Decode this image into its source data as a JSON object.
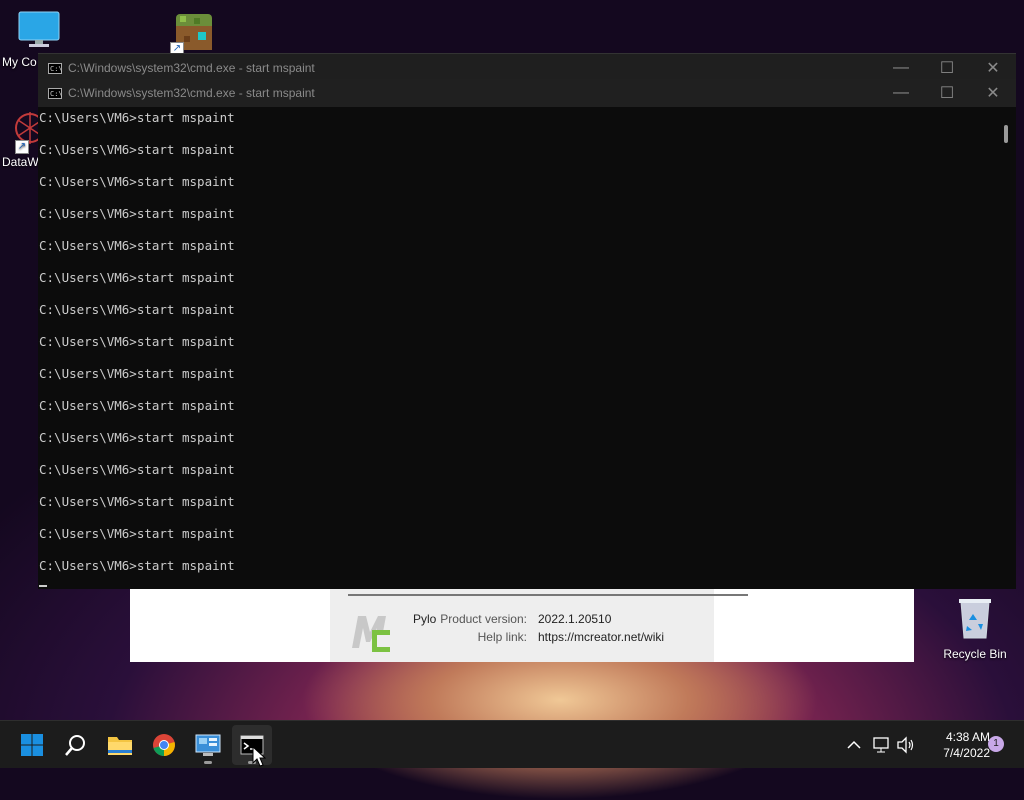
{
  "desktop": {
    "icons": [
      {
        "label": "My Co"
      },
      {
        "label": "DataW"
      }
    ],
    "recycle_bin": {
      "label": "Recycle Bin"
    }
  },
  "mcreator": {
    "name": "Pylo",
    "product_version_label": "Product version:",
    "product_version": "2022.1.20510",
    "help_link_label": "Help link:",
    "help_link": "https://mcreator.net/wiki"
  },
  "cmd_back": {
    "title": "C:\\Windows\\system32\\cmd.exe - start  mspaint",
    "icon_text": "C:\\"
  },
  "cmd_front": {
    "title": "C:\\Windows\\system32\\cmd.exe - start  mspaint",
    "icon_text": "C:\\",
    "lines": [
      "C:\\Users\\VM6>start mspaint",
      "C:\\Users\\VM6>start mspaint",
      "C:\\Users\\VM6>start mspaint",
      "C:\\Users\\VM6>start mspaint",
      "C:\\Users\\VM6>start mspaint",
      "C:\\Users\\VM6>start mspaint",
      "C:\\Users\\VM6>start mspaint",
      "C:\\Users\\VM6>start mspaint",
      "C:\\Users\\VM6>start mspaint",
      "C:\\Users\\VM6>start mspaint",
      "C:\\Users\\VM6>start mspaint",
      "C:\\Users\\VM6>start mspaint",
      "C:\\Users\\VM6>start mspaint",
      "C:\\Users\\VM6>start mspaint",
      "C:\\Users\\VM6>start mspaint"
    ]
  },
  "window_buttons": {
    "minimize": "—",
    "maximize": "☐",
    "close": "✕"
  },
  "taskbar": {
    "time": "4:38 AM",
    "date": "7/4/2022",
    "notification_count": "1",
    "apps": [
      "start",
      "search",
      "file-explorer",
      "chrome",
      "control-panel",
      "command-prompt"
    ]
  },
  "colors": {
    "console_bg": "#0c0c0c",
    "console_text": "#cccccc",
    "taskbar_bg": "#1c1c1c",
    "windows_blue": "#1a8fe0"
  }
}
